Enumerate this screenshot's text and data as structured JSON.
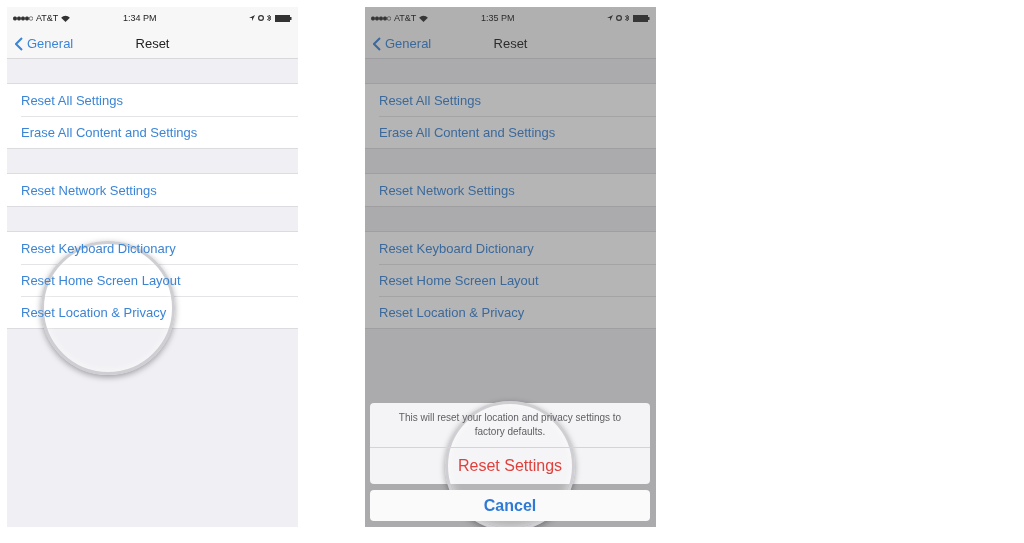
{
  "screens": [
    {
      "status_bar": {
        "carrier": "AT&T",
        "time": "1:34 PM"
      },
      "nav": {
        "back": "General",
        "title": "Reset"
      },
      "groups": [
        [
          "Reset All Settings",
          "Erase All Content and Settings"
        ],
        [
          "Reset Network Settings"
        ],
        [
          "Reset Keyboard Dictionary",
          "Reset Home Screen Layout",
          "Reset Location & Privacy"
        ]
      ],
      "dimmed": false
    },
    {
      "status_bar": {
        "carrier": "AT&T",
        "time": "1:35 PM"
      },
      "nav": {
        "back": "General",
        "title": "Reset"
      },
      "groups": [
        [
          "Reset All Settings",
          "Erase All Content and Settings"
        ],
        [
          "Reset Network Settings"
        ],
        [
          "Reset Keyboard Dictionary",
          "Reset Home Screen Layout",
          "Reset Location & Privacy"
        ]
      ],
      "dimmed": true,
      "action_sheet": {
        "message": "This will reset your location and privacy settings to factory defaults.",
        "action": "Reset Settings",
        "cancel": "Cancel"
      }
    }
  ]
}
